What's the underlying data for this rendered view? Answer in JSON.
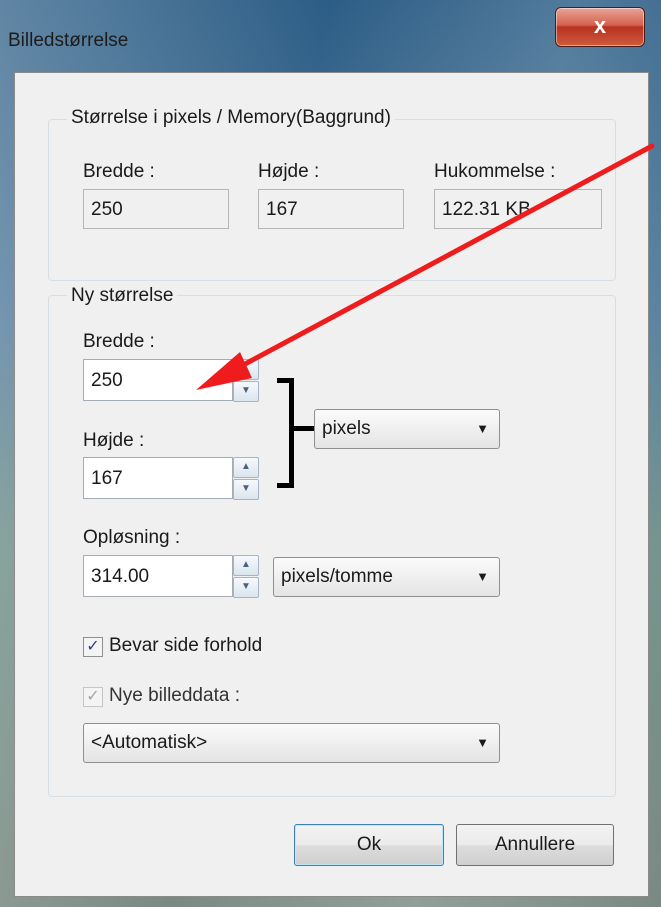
{
  "window": {
    "title": "Billedstørrelse",
    "close_label": "x"
  },
  "current_size": {
    "group_title": "Størrelse i pixels / Memory(Baggrund)",
    "width_label": "Bredde :",
    "width_value": "250",
    "height_label": "Højde :",
    "height_value": "167",
    "memory_label": "Hukommelse :",
    "memory_value": "122.31 KB"
  },
  "new_size": {
    "group_title": "Ny størrelse",
    "width_label": "Bredde :",
    "width_value": "250",
    "height_label": "Højde :",
    "height_value": "167",
    "unit_select": "pixels",
    "resolution_label": "Opløsning :",
    "resolution_value": "314.00",
    "resolution_unit": "pixels/tomme",
    "keep_ratio_label": "Bevar side forhold",
    "keep_ratio_checked": true,
    "new_data_label": "Nye billeddata :",
    "new_data_checked": true,
    "new_data_select": "<Automatisk>"
  },
  "buttons": {
    "ok": "Ok",
    "cancel": "Annullere"
  },
  "glyphs": {
    "spin_up": "▲",
    "spin_down": "▼",
    "dropdown": "▼",
    "check": "✓"
  },
  "colors": {
    "annotation_arrow": "#ee1c1c",
    "bracket": "#000000",
    "dialog_bg": "#f0f0f0",
    "close_button": "#c2422c"
  }
}
